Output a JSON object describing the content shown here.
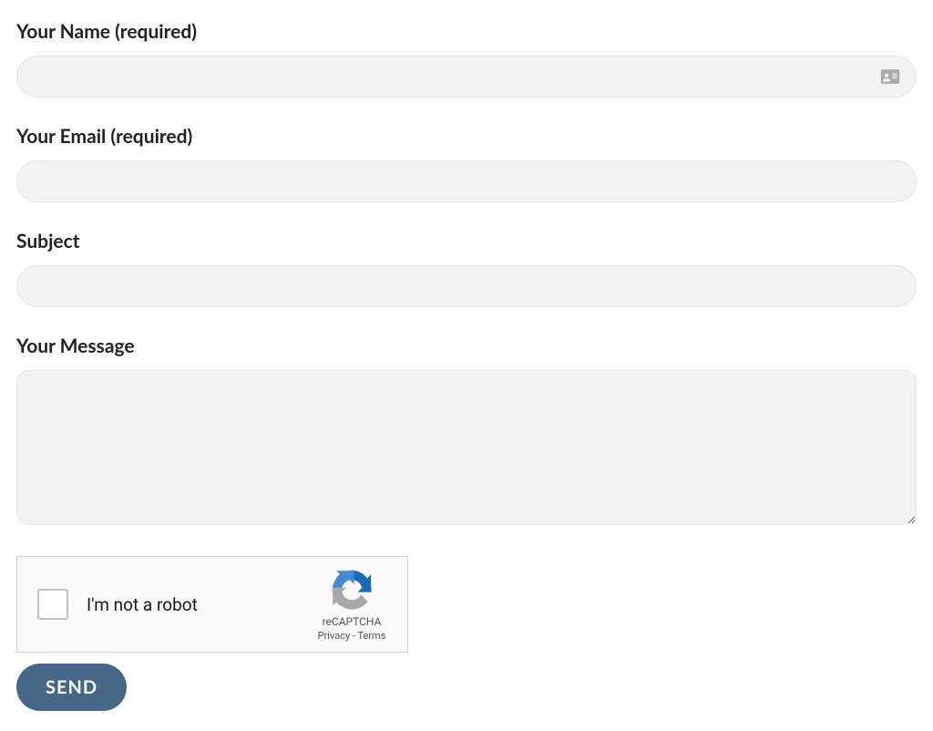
{
  "form": {
    "name_label": "Your Name (required)",
    "name_value": "",
    "email_label": "Your Email (required)",
    "email_value": "",
    "subject_label": "Subject",
    "subject_value": "",
    "message_label": "Your Message",
    "message_value": ""
  },
  "recaptcha": {
    "prompt": "I'm not a robot",
    "brand": "reCAPTCHA",
    "privacy": "Privacy",
    "separator": " - ",
    "terms": "Terms"
  },
  "actions": {
    "send_label": "SEND"
  }
}
